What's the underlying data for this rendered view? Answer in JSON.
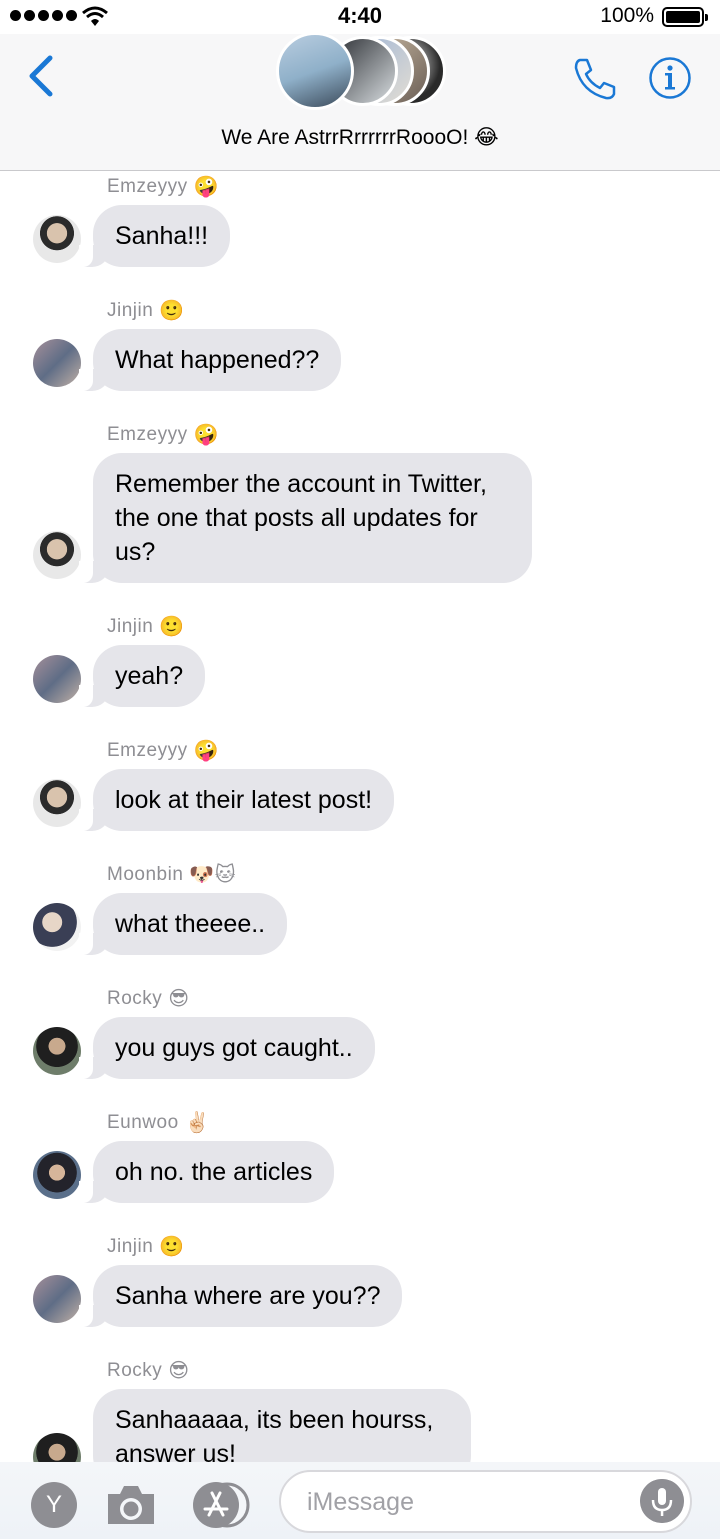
{
  "status_bar": {
    "time": "4:40",
    "battery": "100%"
  },
  "header": {
    "group_name": "We Are AstrrRrrrrrrRoooO! 😂"
  },
  "messages": [
    {
      "sender": "Emzeyyy",
      "emoji": "🤪",
      "text": "Sanha!!!"
    },
    {
      "sender": "Jinjin",
      "emoji": "🙂",
      "text": "What happened??"
    },
    {
      "sender": "Emzeyyy",
      "emoji": "🤪",
      "text": "Remember the account in Twitter, the one that posts all updates for us?"
    },
    {
      "sender": "Jinjin",
      "emoji": "🙂",
      "text": "yeah?"
    },
    {
      "sender": "Emzeyyy",
      "emoji": "🤪",
      "text": "look at their latest post!"
    },
    {
      "sender": "Moonbin",
      "emoji": "🐶🐱",
      "text": "what theeee.."
    },
    {
      "sender": "Rocky",
      "emoji": "😎",
      "text": "you guys got caught.."
    },
    {
      "sender": "Eunwoo",
      "emoji": "✌🏻",
      "text": "oh no. the articles"
    },
    {
      "sender": "Jinjin",
      "emoji": "🙂",
      "text": "Sanha where are you??"
    },
    {
      "sender": "Rocky",
      "emoji": "😎",
      "text": "Sanhaaaaa, its been hourss, answer us!"
    }
  ],
  "composer": {
    "apps_label": "Y",
    "placeholder": "iMessage"
  },
  "colors": {
    "accent": "#1a78d5",
    "bubble": "#e5e5ea",
    "sender": "#8e8e93"
  }
}
